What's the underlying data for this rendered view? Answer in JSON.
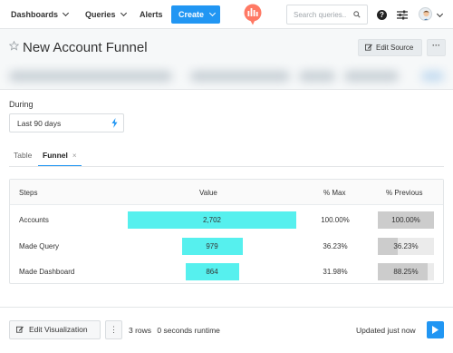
{
  "nav": {
    "dashboards": "Dashboards",
    "queries": "Queries",
    "alerts": "Alerts",
    "create": "Create",
    "search_placeholder": "Search queries..",
    "help": "?"
  },
  "title": "New Account Funnel",
  "header_actions": {
    "edit_source": "Edit Source",
    "more": "···"
  },
  "params": {
    "during_label": "During",
    "date_value": "Last 90 days"
  },
  "tabs": [
    {
      "label": "Table",
      "active": false
    },
    {
      "label": "Funnel",
      "active": true,
      "close": "×"
    }
  ],
  "funnel": {
    "headers": {
      "steps": "Steps",
      "value": "Value",
      "pct_max": "% Max",
      "pct_previous": "% Previous"
    },
    "rows": [
      {
        "step": "Accounts",
        "value": "2,702",
        "pct_max": "100.00%",
        "pct_previous": "100.00%",
        "max_fraction": 1.0,
        "prev_fraction": 1.0
      },
      {
        "step": "Made Query",
        "value": "979",
        "pct_max": "36.23%",
        "pct_previous": "36.23%",
        "max_fraction": 0.3623,
        "prev_fraction": 0.3623
      },
      {
        "step": "Made Dashboard",
        "value": "864",
        "pct_max": "31.98%",
        "pct_previous": "88.25%",
        "max_fraction": 0.3198,
        "prev_fraction": 0.8825
      }
    ],
    "bar_color": "#56f0ee",
    "prev_color": "#cccccc"
  },
  "footer": {
    "edit_visualization": "Edit Visualization",
    "more": "⋮",
    "rows_info": "3 rows",
    "runtime": "0 seconds runtime",
    "updated": "Updated just now"
  },
  "colors": {
    "accent": "#2196f3",
    "logo": "#ff7964"
  }
}
